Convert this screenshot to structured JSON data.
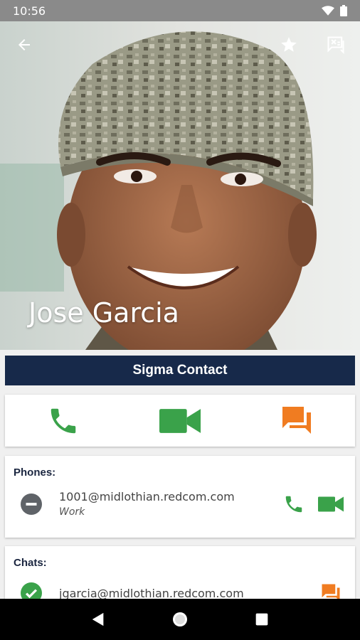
{
  "status_bar": {
    "time": "10:56"
  },
  "contact": {
    "name": "Jose Garcia"
  },
  "banner": {
    "label": "Sigma Contact"
  },
  "phones": {
    "title": "Phones:",
    "items": [
      {
        "address": "1001@midlothian.redcom.com",
        "type": "Work"
      }
    ]
  },
  "chats": {
    "title": "Chats:",
    "items": [
      {
        "address": "jgarcia@midlothian.redcom.com"
      }
    ]
  },
  "colors": {
    "green": "#3aa24a",
    "orange": "#f07c21",
    "navy": "#17294a"
  }
}
